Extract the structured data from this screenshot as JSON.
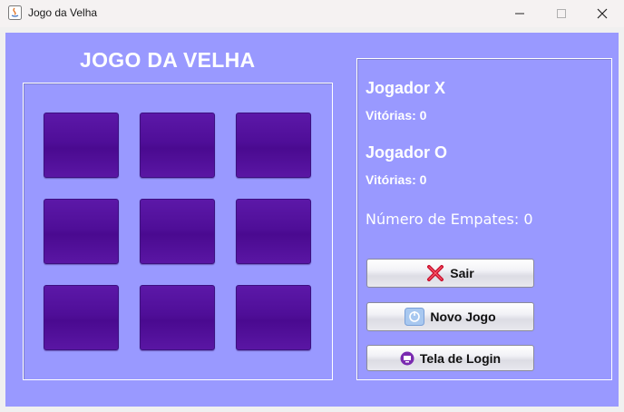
{
  "window": {
    "title": "Jogo da Velha"
  },
  "game": {
    "title": "JOGO DA VELHA"
  },
  "board": {
    "cells": [
      "",
      "",
      "",
      "",
      "",
      "",
      "",
      "",
      ""
    ]
  },
  "score": {
    "player_x": {
      "name": "Jogador X",
      "wins_label": "Vitórias: 0"
    },
    "player_o": {
      "name": "Jogador O",
      "wins_label": "Vitórias: 0"
    },
    "draws_label": "Número de Empates: 0"
  },
  "buttons": {
    "exit": {
      "label": "Sair",
      "icon": "red-x-icon"
    },
    "new_game": {
      "label": "Novo Jogo",
      "icon": "refresh-icon"
    },
    "login_screen": {
      "label": "Tela de Login",
      "icon": "login-screen-icon"
    }
  },
  "colors": {
    "background": "#9999ff",
    "cell": "#4f0e98",
    "text": "#ffffff"
  }
}
